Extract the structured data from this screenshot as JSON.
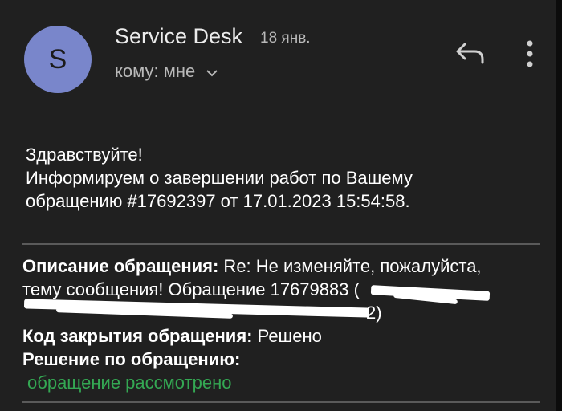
{
  "header": {
    "avatar_letter": "S",
    "sender": "Service Desk",
    "date": "18 янв.",
    "to_label": "кому: мне"
  },
  "icons": {
    "reply": "reply-icon",
    "more": "more-vert-icon",
    "expand": "chevron-down-icon"
  },
  "message": {
    "greeting": "Здравствуйте!",
    "line2": "Информируем о завершении работ по Вашему",
    "line3": "обращению #17692397 от 17.01.2023 15:54:58."
  },
  "details": {
    "desc_label": "Описание обращения:",
    "desc_text1": " Re: Не изменяйте, пожалуйста,",
    "desc_text2": "тему сообщения! Обращение 17679883 (",
    "desc_text3_end": "2)",
    "close_code_label": "Код закрытия обращения:",
    "close_code_value": " Решено",
    "resolution_label": "Решение по обращению:",
    "resolution_value": "обращение рассмотрено"
  },
  "colors": {
    "background": "#202020",
    "avatar": "#7986cb",
    "green": "#34a853"
  }
}
